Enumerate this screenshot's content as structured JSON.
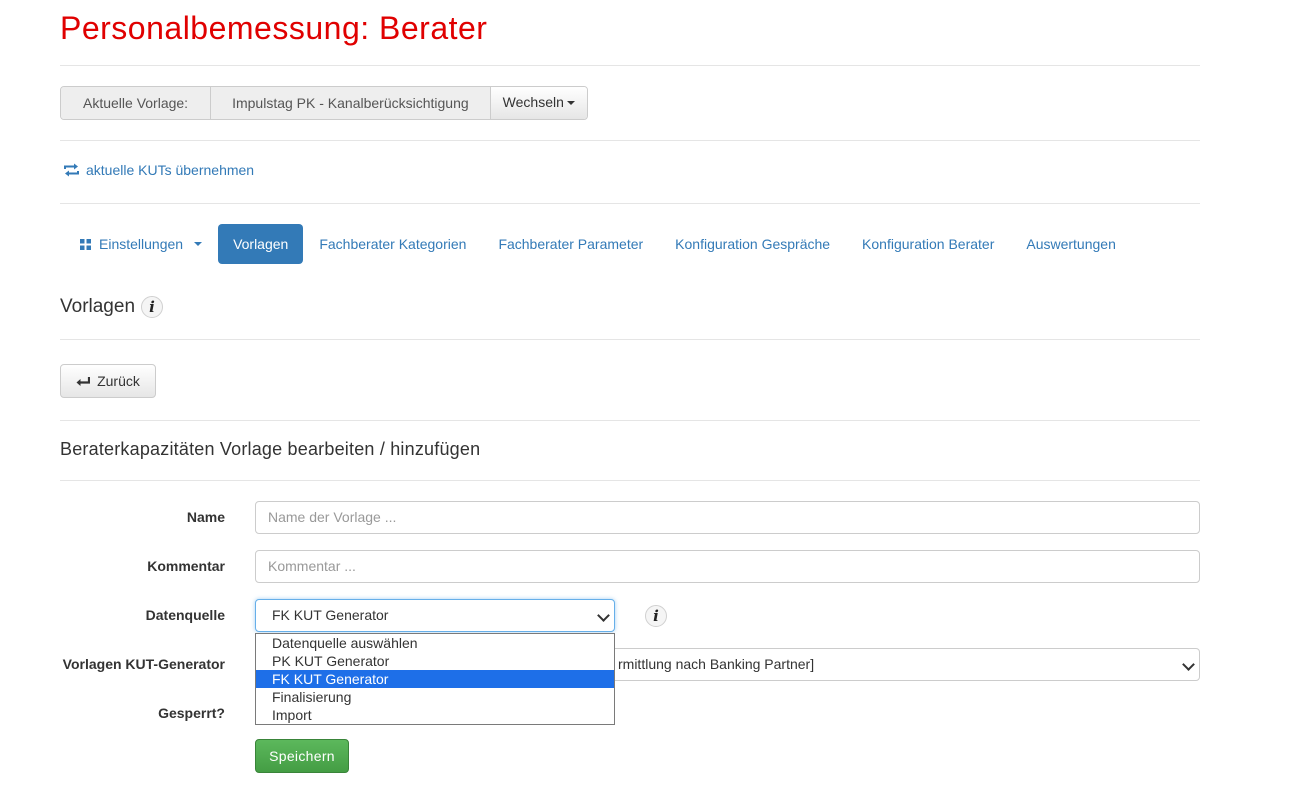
{
  "page_title": "Personalbemessung: Berater",
  "vorlage_bar": {
    "label": "Aktuelle Vorlage:",
    "value": "Impulstag PK - Kanalberücksichtigung",
    "switch_label": "Wechseln"
  },
  "kut_link": "aktuelle KUTs übernehmen",
  "nav": {
    "settings_label": "Einstellungen",
    "tabs": [
      {
        "label": "Vorlagen",
        "active": true
      },
      {
        "label": "Fachberater Kategorien"
      },
      {
        "label": "Fachberater Parameter"
      },
      {
        "label": "Konfiguration Gespräche"
      },
      {
        "label": "Konfiguration Berater"
      },
      {
        "label": "Auswertungen"
      }
    ]
  },
  "section_title": "Vorlagen",
  "back_button": "Zurück",
  "form": {
    "title": "Beraterkapazitäten Vorlage bearbeiten / hinzufügen",
    "name_label": "Name",
    "name_placeholder": "Name der Vorlage ...",
    "comment_label": "Kommentar",
    "comment_placeholder": "Kommentar ...",
    "source_label": "Datenquelle",
    "source_selected": "FK KUT Generator",
    "source_options": [
      "Datenquelle auswählen",
      "PK KUT Generator",
      "FK KUT Generator",
      "Finalisierung",
      "Import"
    ],
    "generator_label": "Vorlagen KUT-Generator",
    "generator_selected_visible": "rmittlung nach Banking Partner]",
    "locked_label": "Gesperrt?",
    "save_label": "Speichern"
  },
  "colors": {
    "title_red": "#e00000",
    "link_blue": "#337ab7",
    "option_highlight": "#1e6fe8",
    "save_green": "#5cb85c"
  }
}
